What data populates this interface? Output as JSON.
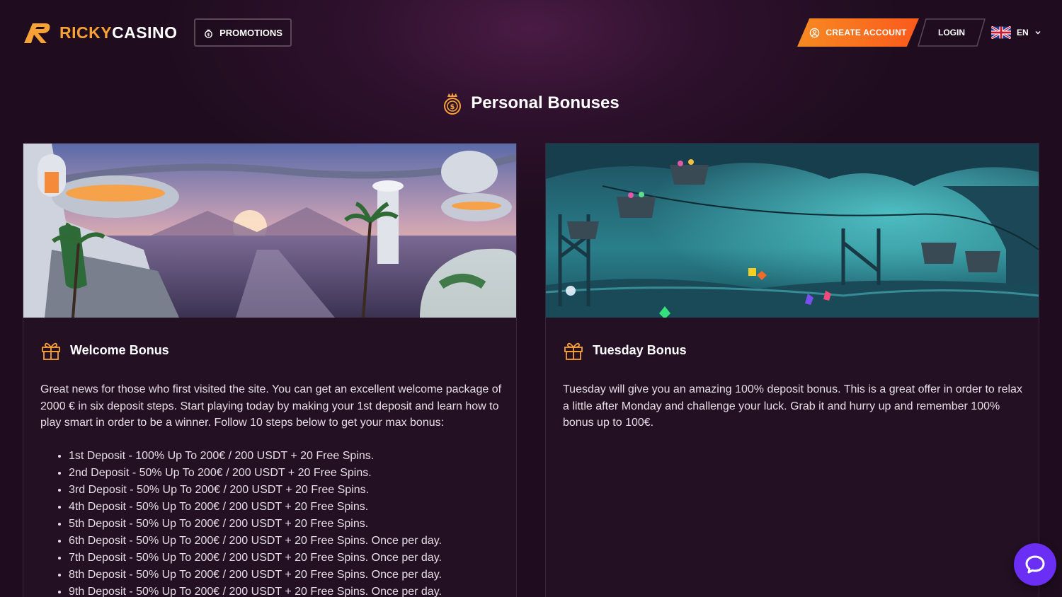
{
  "brand": {
    "name_part1": "RICKY",
    "name_part2": "CASINO",
    "accent_color": "#f7a136"
  },
  "nav": {
    "promotions_label": "PROMOTIONS",
    "create_account_label": "CREATE ACCOUNT",
    "login_label": "LOGIN",
    "language": "EN"
  },
  "page": {
    "title": "Personal Bonuses"
  },
  "cards": [
    {
      "title": "Welcome Bonus",
      "description": "Great news for those who first visited the site. You can get an excellent welcome package of 2000 € in six deposit steps. Start playing today by making your 1st deposit and learn how to play smart in order to be a winner. Follow 10 steps below to get your max bonus:",
      "items": [
        "1st Deposit - 100% Up To 200€ / 200 USDT + 20 Free Spins.",
        "2nd Deposit - 50% Up To 200€ / 200 USDT + 20 Free Spins.",
        "3rd Deposit - 50% Up To 200€ / 200 USDT + 20 Free Spins.",
        "4th Deposit - 50% Up To 200€ / 200 USDT + 20 Free Spins.",
        "5th Deposit - 50% Up To 200€ / 200 USDT + 20 Free Spins.",
        "6th Deposit - 50% Up To 200€ / 200 USDT + 20 Free Spins. Once per day.",
        "7th Deposit - 50% Up To 200€ / 200 USDT + 20 Free Spins. Once per day.",
        "8th Deposit - 50% Up To 200€ / 200 USDT + 20 Free Spins. Once per day.",
        "9th Deposit - 50% Up To 200€ / 200 USDT + 20 Free Spins. Once per day."
      ]
    },
    {
      "title": "Tuesday Bonus",
      "description": "Tuesday will give you an amazing 100% deposit bonus. This is a great offer in order to relax a little after Monday and challenge your luck. Grab it and hurry up and remember 100% bonus up to 100€."
    }
  ],
  "icons": {
    "logo": "ricky-r-logo-icon",
    "promotions": "money-bag-icon",
    "create_account": "user-circle-icon",
    "language_flag": "uk-flag-icon",
    "chevron": "chevron-down-icon",
    "section": "coin-crown-icon",
    "gift": "gift-icon",
    "chat": "chat-bubble-icon"
  }
}
